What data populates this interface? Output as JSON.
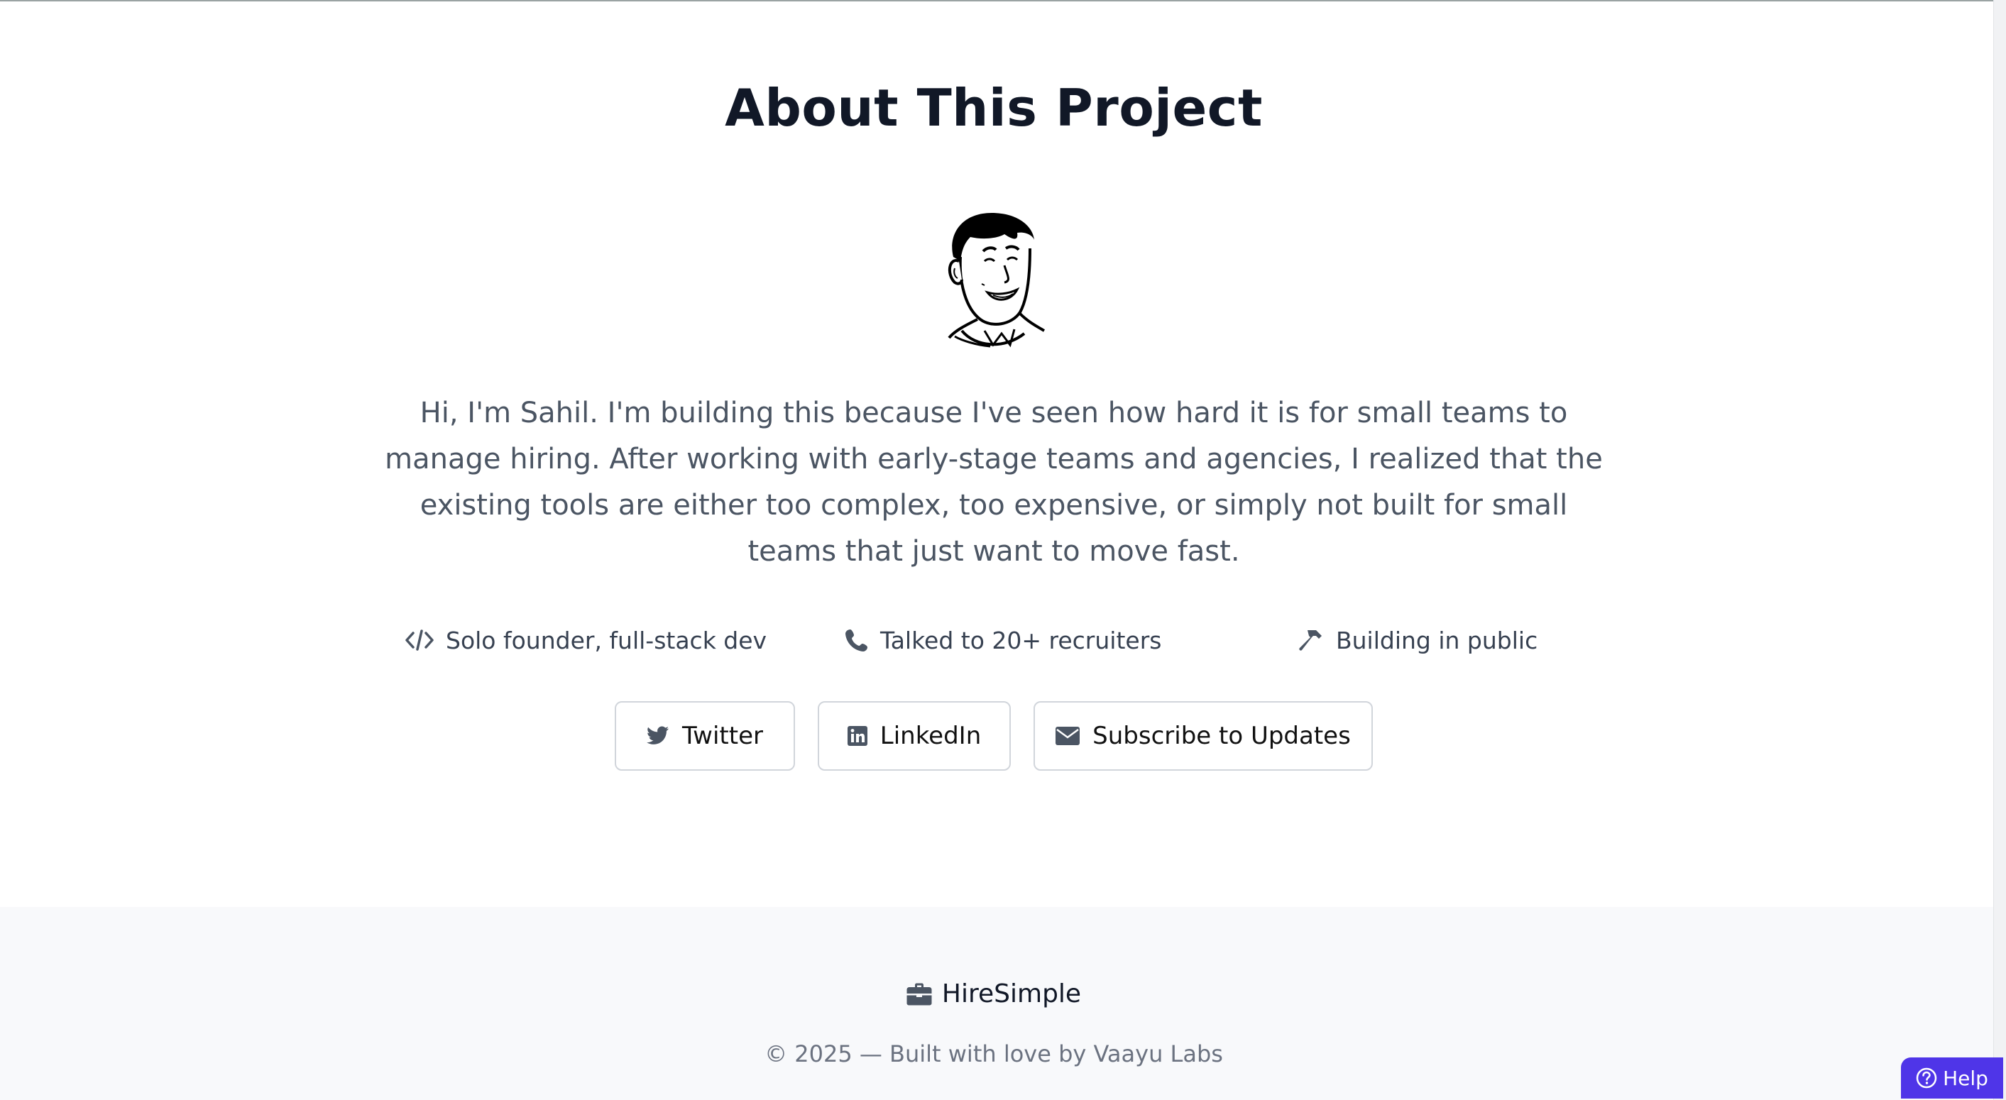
{
  "page": {
    "title": "About This Project",
    "about_text": "Hi, I'm Sahil. I'm building this because I've seen how hard it is for small teams to manage hiring. After working with early-stage teams and agencies, I realized that the existing tools are either too complex, too expensive, or simply not built for small teams that just want to move fast."
  },
  "facts": [
    {
      "icon": "code-icon",
      "label": "Solo founder, full-stack dev"
    },
    {
      "icon": "phone-icon",
      "label": "Talked to 20+ recruiters"
    },
    {
      "icon": "hammer-icon",
      "label": "Building in public"
    }
  ],
  "buttons": {
    "twitter": {
      "icon": "twitter-icon",
      "label": "Twitter"
    },
    "linkedin": {
      "icon": "linkedin-icon",
      "label": "LinkedIn"
    },
    "subscribe": {
      "icon": "envelope-icon",
      "label": "Subscribe to Updates"
    }
  },
  "footer": {
    "brand_icon": "briefcase-icon",
    "brand": "HireSimple",
    "copyright": "© 2025 — Built with love by Vaayu Labs"
  },
  "help": {
    "icon": "question-circle-icon",
    "label": "Help"
  },
  "colors": {
    "heading": "#111827",
    "body_text": "#4b5563",
    "icon_gray": "#4b5563",
    "help_bg": "#4f35e8",
    "footer_bg": "#f8f9fb"
  }
}
